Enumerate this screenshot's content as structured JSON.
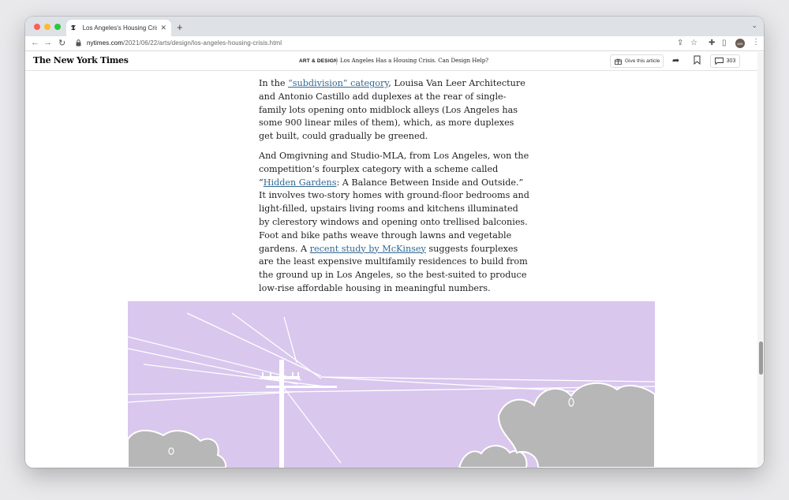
{
  "browser": {
    "tab_title": "Los Angeles's Housing Crisis:",
    "tab_favicon": "𝕿",
    "new_tab_icon": "+",
    "close_tab_icon": "✕",
    "url_host": "nytimes.com",
    "url_path": "/2021/06/22/arts/design/los-angeles-housing-crisis.html",
    "profile_initials": "MIS",
    "icons": [
      "back-arrow-icon",
      "forward-arrow-icon",
      "reload-icon",
      "lock-icon",
      "share-icon",
      "star-icon",
      "extensions-icon",
      "side-panel-icon",
      "kebab-menu-icon"
    ]
  },
  "nyt_header": {
    "logo": "The New York Times",
    "section": "ART & DESIGN",
    "headline": "Los Angeles Has a Housing Crisis. Can Design Help?",
    "gift_label": "Give this article",
    "comment_count": "303"
  },
  "article": {
    "p1": {
      "before": "In the ",
      "link": "“subdivision” category",
      "after": ", Louisa Van Leer Architecture and Antonio Castillo add duplexes at the rear of single-family lots opening onto midblock alleys (Los Angeles has some 900 linear miles of them), which, as more duplexes get built, could gradually be greened."
    },
    "p2": {
      "before": "And Omgivning and Studio-MLA, from Los Angeles, won the competition’s fourplex category with a scheme called “",
      "link1": "Hidden Gardens",
      "middle": ": A Balance Between Inside and Outside.” It involves two-story homes with ground-floor bedrooms and light-filled, upstairs living rooms and kitchens illuminated by clerestory windows and opening onto trellised balconies. Foot and bike paths weave through lawns and vegetable gardens. A ",
      "link2": "recent study by McKinsey",
      "after": " suggests fourplexes are the least expensive multifamily residences to build from the ground up in Los Angeles, so the best-suited to produce low-rise affordable housing in meaningful numbers."
    }
  },
  "colors": {
    "link": "#326891",
    "illustration_bg": "#d9c7ee",
    "tree": "#b7b7b7"
  }
}
